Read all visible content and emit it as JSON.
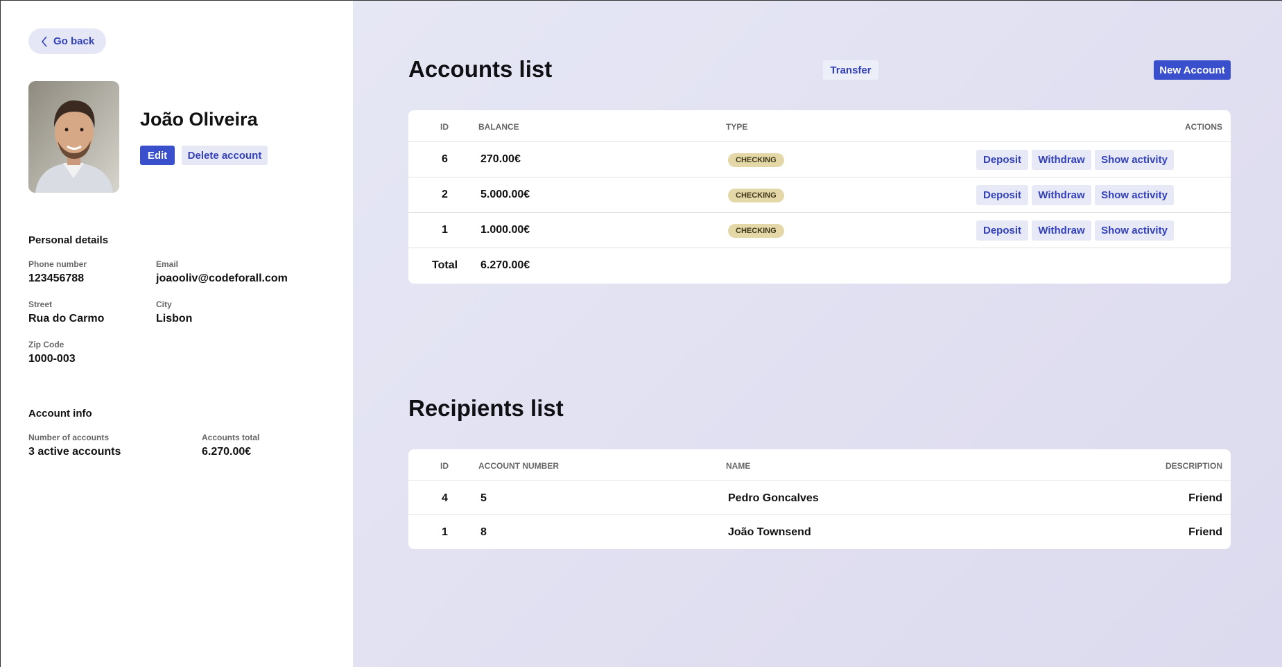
{
  "sidebar": {
    "go_back": "Go back",
    "user_name": "João Oliveira",
    "edit_label": "Edit",
    "delete_label": "Delete account",
    "personal": {
      "title": "Personal details",
      "phone_label": "Phone number",
      "phone": "123456788",
      "email_label": "Email",
      "email": "joaooliv@codeforall.com",
      "street_label": "Street",
      "street": "Rua do Carmo",
      "city_label": "City",
      "city": "Lisbon",
      "zip_label": "Zip Code",
      "zip": "1000-003"
    },
    "account_info": {
      "title": "Account info",
      "num_label": "Number of accounts",
      "num": "3 active accounts",
      "total_label": "Accounts total",
      "total": "6.270.00€"
    }
  },
  "accounts": {
    "heading": "Accounts list",
    "transfer_label": "Transfer",
    "new_account_label": "New Account",
    "columns": [
      "ID",
      "BALANCE",
      "TYPE",
      "ACTIONS"
    ],
    "rows": [
      {
        "id": "6",
        "balance": "270.00€",
        "type": "CHECKING"
      },
      {
        "id": "2",
        "balance": "5.000.00€",
        "type": "CHECKING"
      },
      {
        "id": "1",
        "balance": "1.000.00€",
        "type": "CHECKING"
      }
    ],
    "actions": {
      "deposit": "Deposit",
      "withdraw": "Withdraw",
      "activity": "Show activity"
    },
    "total_label": "Total",
    "total_value": "6.270.00€"
  },
  "recipients": {
    "heading": "Recipients list",
    "columns": [
      "ID",
      "ACCOUNT NUMBER",
      "NAME",
      "DESCRIPTION"
    ],
    "rows": [
      {
        "id": "4",
        "account": "5",
        "name": "Pedro Goncalves",
        "description": "Friend"
      },
      {
        "id": "1",
        "account": "8",
        "name": "João Townsend",
        "description": "Friend"
      }
    ]
  },
  "colors": {
    "primary": "#3a4fcc",
    "secondary_bg": "#e7e8f6",
    "badge": "#e4d7a8"
  }
}
